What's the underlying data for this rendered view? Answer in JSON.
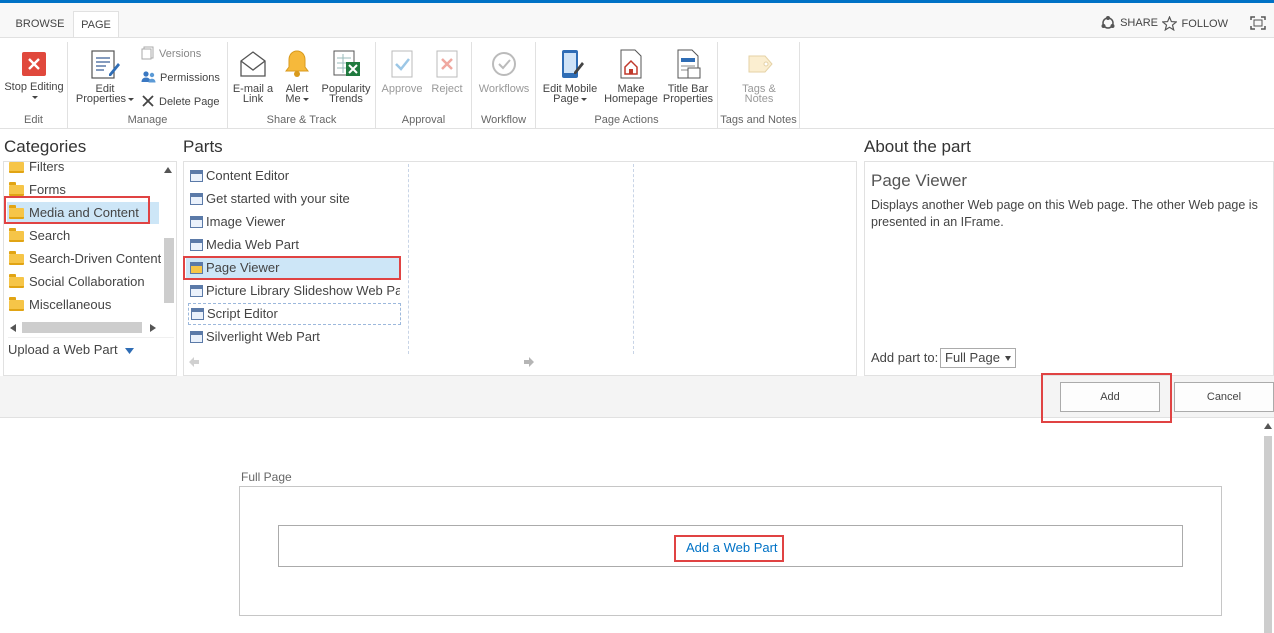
{
  "tabs": {
    "browse": "BROWSE",
    "page": "PAGE"
  },
  "topright": {
    "share": "SHARE",
    "follow": "FOLLOW"
  },
  "ribbon": {
    "edit": {
      "stop_editing": "Stop Editing",
      "group": "Edit"
    },
    "manage": {
      "edit_properties_line1": "Edit",
      "edit_properties_line2": "Properties",
      "versions": "Versions",
      "permissions": "Permissions",
      "delete_page": "Delete Page",
      "group": "Manage"
    },
    "share_track": {
      "email_line1": "E-mail a",
      "email_line2": "Link",
      "alert_line1": "Alert",
      "alert_line2": "Me",
      "popularity_line1": "Popularity",
      "popularity_line2": "Trends",
      "group": "Share & Track"
    },
    "approval": {
      "approve": "Approve",
      "reject": "Reject",
      "group": "Approval"
    },
    "workflow": {
      "workflows": "Workflows",
      "group": "Workflow"
    },
    "page_actions": {
      "mobile_line1": "Edit Mobile",
      "mobile_line2": "Page",
      "homepage_line1": "Make",
      "homepage_line2": "Homepage",
      "titlebar_line1": "Title Bar",
      "titlebar_line2": "Properties",
      "group": "Page Actions"
    },
    "tags_notes": {
      "line1": "Tags &",
      "line2": "Notes",
      "group": "Tags and Notes"
    }
  },
  "categories": {
    "heading": "Categories",
    "items": [
      "Filters",
      "Forms",
      "Media and Content",
      "Search",
      "Search-Driven Content",
      "Social Collaboration",
      "Miscellaneous"
    ],
    "selected_index": 2,
    "upload": "Upload a Web Part"
  },
  "parts": {
    "heading": "Parts",
    "items": [
      "Content Editor",
      "Get started with your site",
      "Image Viewer",
      "Media Web Part",
      "Page Viewer",
      "Picture Library Slideshow Web Part",
      "Script Editor",
      "Silverlight Web Part"
    ],
    "selected_index": 4
  },
  "about": {
    "heading": "About the part",
    "title": "Page Viewer",
    "description": "Displays another Web page on this Web page. The other Web page is presented in an IFrame.",
    "add_part_to_label": "Add part to:",
    "add_part_to_value": "Full Page"
  },
  "buttons": {
    "add": "Add",
    "cancel": "Cancel"
  },
  "page": {
    "zone_label": "Full Page",
    "add_web_part": "Add a Web Part"
  },
  "colors": {
    "accent": "#0072c6",
    "highlight": "#e04343",
    "selected_bg": "#cde6f7"
  }
}
